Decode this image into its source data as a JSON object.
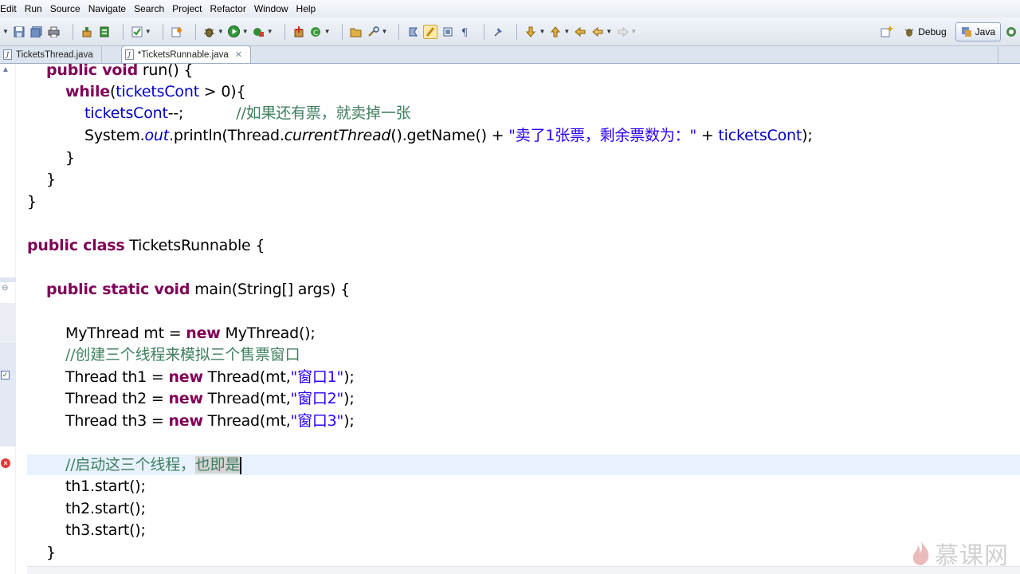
{
  "menu": [
    "Edit",
    "Run",
    "Source",
    "Navigate",
    "Search",
    "Project",
    "Refactor",
    "Window",
    "Help"
  ],
  "toolbar": {
    "perspectives": [
      {
        "label": "Debug",
        "active": false
      },
      {
        "label": "Java",
        "active": true
      }
    ]
  },
  "tabs": [
    {
      "label": "TicketsThread.java",
      "active": false,
      "closable": false
    },
    {
      "label": "*TicketsRunnable.java",
      "active": true,
      "closable": true
    }
  ],
  "code": {
    "l1": {
      "kw1": "public void",
      "t1": " run() {"
    },
    "l2": {
      "kw1": "while",
      "t1": "(",
      "f1": "ticketsCont",
      "t2": " > 0){"
    },
    "l3": {
      "f1": "ticketsCont",
      "t1": "--;",
      "c1": "//如果还有票，就卖掉一张"
    },
    "l4": {
      "t1": "System.",
      "i1": "out",
      "t2": ".println(Thread.",
      "i2": "currentThread",
      "t3": "().getName() + ",
      "s1": "\"卖了1张票，剩余票数为：\"",
      "t4": " + ",
      "f1": "ticketsCont",
      "t5": ");"
    },
    "l5": "}",
    "l6": "}",
    "l7": "}",
    "l8": {
      "kw1": "public class",
      "t1": " TicketsRunnable {"
    },
    "l9": {
      "kw1": "public static void",
      "t1": " main(String[] args) {"
    },
    "l10": {
      "t1": "MyThread mt = ",
      "kw1": "new",
      "t2": " MyThread();"
    },
    "l11": "//创建三个线程来模拟三个售票窗口",
    "l12": {
      "t1": "Thread th1 = ",
      "kw1": "new",
      "t2": " Thread(mt,",
      "s1": "\"窗口1\"",
      "t3": ");"
    },
    "l13": {
      "t1": "Thread th2 = ",
      "kw1": "new",
      "t2": " Thread(mt,",
      "s1": "\"窗口2\"",
      "t3": ");"
    },
    "l14": {
      "t1": "Thread th3 = ",
      "kw1": "new",
      "t2": " Thread(mt,",
      "s1": "\"窗口3\"",
      "t3": ");"
    },
    "l15": {
      "c1": "//启动这三个线程，",
      "c2": "也即是"
    },
    "l16": "th1.start();",
    "l17": "th2.start();",
    "l18": "th3.start();",
    "l19": "}"
  },
  "watermark": "慕课网"
}
